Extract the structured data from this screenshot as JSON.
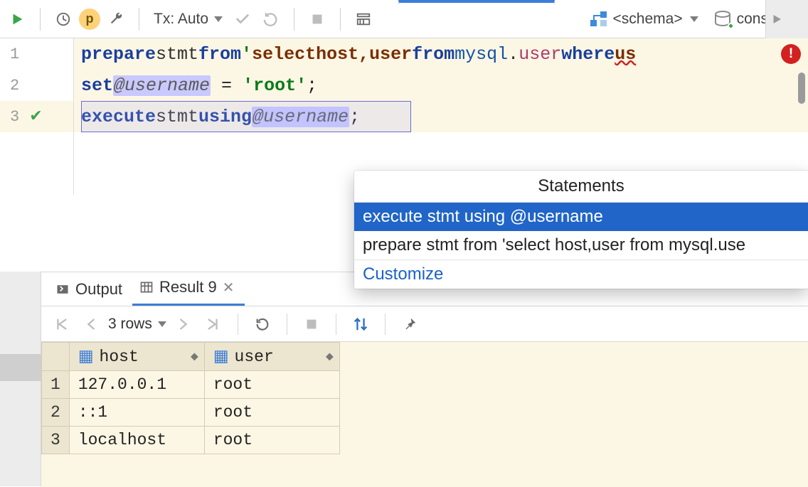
{
  "toolbar": {
    "tx_label": "Tx: Auto",
    "schema_label": "<schema>",
    "console_label": "console",
    "pbadge": "p"
  },
  "editor": {
    "lines": [
      "1",
      "2",
      "3"
    ],
    "l1": {
      "prepare": "prepare",
      "stmt": "stmt",
      "from": "from",
      "q1": "'",
      "select": "select",
      "host": "host",
      "comma": ",",
      "user": "user",
      "from2": "from",
      "mysql": "mysql",
      "dot": ".",
      "usertbl": "user",
      "where": "where",
      "us_trunc": "us"
    },
    "l2": {
      "set": "set",
      "var": "@username",
      "eq": " = ",
      "root": "'root'",
      "semi": ";"
    },
    "l3": {
      "execute": "execute",
      "stmt": "stmt",
      "using": "using",
      "var": "@username",
      "semi": ";"
    }
  },
  "popup": {
    "title": "Statements",
    "items": [
      "execute stmt using @username",
      "prepare stmt from 'select host,user from mysql.use"
    ],
    "link": "Customize"
  },
  "tabs": {
    "output": "Output",
    "result": "Result 9"
  },
  "result_bar": {
    "rows": "3 rows"
  },
  "grid": {
    "cols": [
      "host",
      "user"
    ],
    "rows": [
      {
        "n": "1",
        "host": "127.0.0.1",
        "user": "root"
      },
      {
        "n": "2",
        "host": "::1",
        "user": "root"
      },
      {
        "n": "3",
        "host": "localhost",
        "user": "root"
      }
    ]
  }
}
